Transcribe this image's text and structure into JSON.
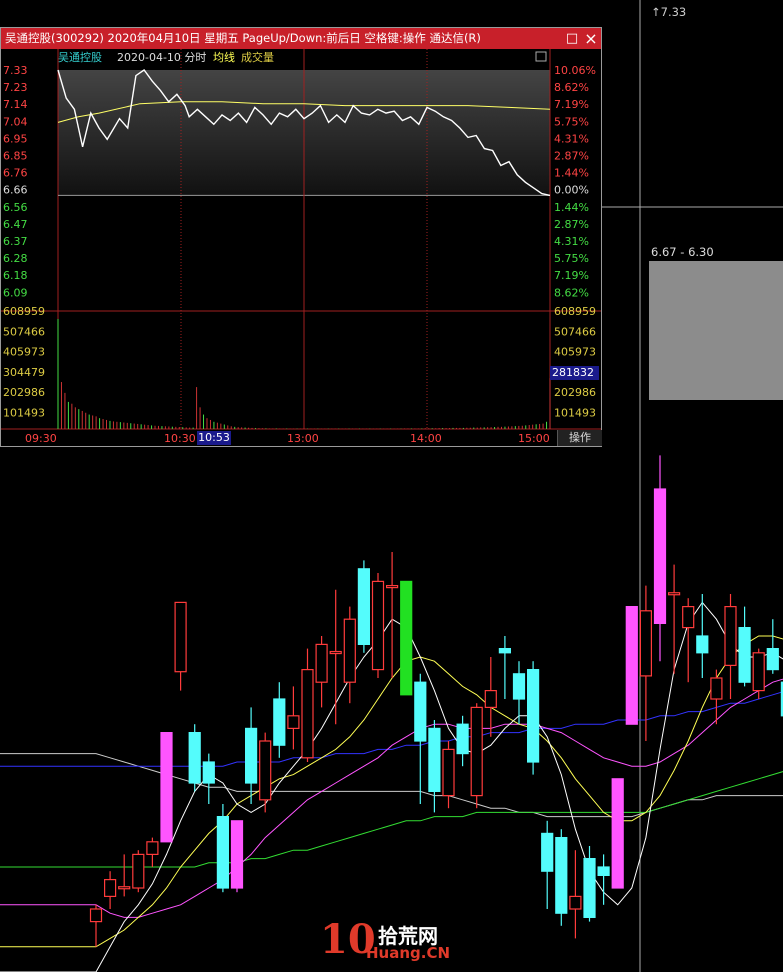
{
  "popup": {
    "title": "吴通控股(300292) 2020年04月10日 星期五 PageUp/Down:前后日 空格键:操作 通达信(R)",
    "legend_name": "吴通控股",
    "legend_date": "2020-04-10 分时",
    "legend_avg": "均线",
    "legend_vol": "成交量",
    "minimize_icon": "□",
    "close_icon": "×",
    "vol_current": "281832",
    "time_marker": "10:53",
    "op_tab": "操作"
  },
  "kchart": {
    "cursor_price": "7.33",
    "range_label": "6.67 - 6.30"
  },
  "watermark": {
    "num": "10",
    "cn": "拾荒网",
    "url": "Huang.CN"
  },
  "colors": {
    "up": "#ff3b3b",
    "down": "#54fcfc",
    "limit_up": "#ff55ff",
    "limit_down": "#22e022",
    "ma5": "#ffffff",
    "ma10": "#ffff55",
    "ma20": "#ff55ff",
    "ma60": "#3333ff",
    "ma120": "#33dd33",
    "ma250": "#cccccc",
    "price_line": "#ffffff",
    "avg_line": "#ffff66",
    "axis_red": "#ff4444",
    "axis_green": "#44dd44",
    "axis_vol": "#ddcc44"
  },
  "chart_data": [
    {
      "type": "line",
      "title": "吴通控股 2020-04-10 分时",
      "x_ticks": [
        "09:30",
        "10:30",
        "13:00",
        "14:00",
        "15:00"
      ],
      "price_ticks": [
        "7.33",
        "7.23",
        "7.14",
        "7.04",
        "6.95",
        "6.85",
        "6.76",
        "6.66",
        "6.56",
        "6.47",
        "6.37",
        "6.28",
        "6.18",
        "6.09"
      ],
      "pct_ticks": [
        "10.06%",
        "8.62%",
        "7.19%",
        "5.75%",
        "4.31%",
        "2.87%",
        "1.44%",
        "0.00%",
        "1.44%",
        "2.87%",
        "4.31%",
        "5.75%",
        "7.19%",
        "8.62%"
      ],
      "vol_ticks": [
        "608959",
        "507466",
        "405973",
        "304479",
        "202986",
        "101493"
      ],
      "ylim": [
        6.0,
        7.33
      ],
      "prev_close": 6.66,
      "series": [
        {
          "name": "分时",
          "x": [
            0,
            4,
            8,
            12,
            16,
            20,
            24,
            30,
            34,
            38,
            42,
            46,
            50,
            54,
            58,
            62,
            64,
            68,
            72,
            76,
            80,
            84,
            88,
            92,
            96,
            100,
            104,
            108,
            112,
            116,
            120,
            124,
            128,
            132,
            136,
            140,
            144,
            148,
            152,
            156,
            160,
            164,
            168,
            172,
            176,
            180,
            184,
            188,
            192,
            196,
            200,
            204,
            208,
            212,
            216,
            220,
            224,
            228,
            232,
            236,
            240
          ],
          "values": [
            7.33,
            7.18,
            7.12,
            6.92,
            7.1,
            7.02,
            6.96,
            7.07,
            7.02,
            7.3,
            7.33,
            7.27,
            7.22,
            7.16,
            7.2,
            7.14,
            7.08,
            7.12,
            7.08,
            7.04,
            7.09,
            7.06,
            7.1,
            7.05,
            7.13,
            7.09,
            7.04,
            7.1,
            7.08,
            7.12,
            7.07,
            7.1,
            7.14,
            7.05,
            7.09,
            7.05,
            7.14,
            7.1,
            7.09,
            7.12,
            7.1,
            7.11,
            7.06,
            7.08,
            7.04,
            7.13,
            7.11,
            7.08,
            7.06,
            7.02,
            6.97,
            6.98,
            6.91,
            6.9,
            6.82,
            6.84,
            6.77,
            6.73,
            6.7,
            6.67,
            6.66
          ]
        },
        {
          "name": "均线",
          "x": [
            0,
            10,
            20,
            40,
            60,
            80,
            100,
            120,
            140,
            160,
            180,
            200,
            220,
            240
          ],
          "values": [
            7.05,
            7.08,
            7.1,
            7.15,
            7.16,
            7.16,
            7.15,
            7.15,
            7.14,
            7.14,
            7.14,
            7.14,
            7.13,
            7.12
          ]
        }
      ],
      "volume": [
        608959,
        260000,
        200000,
        150000,
        140000,
        120000,
        110000,
        100000,
        90000,
        80000,
        75000,
        70000,
        60000,
        55000,
        50000,
        45000,
        42000,
        40000,
        38000,
        36000,
        34000,
        32000,
        30000,
        28000,
        26000,
        24000,
        22000,
        20000,
        18000,
        17000,
        16000,
        15000,
        14000,
        13000,
        12000,
        11000,
        10000,
        9000,
        8000,
        8000,
        232000,
        120000,
        80000,
        60000,
        50000,
        40000,
        35000,
        30000,
        25000,
        20000,
        15000,
        12000,
        10000,
        9000,
        8000,
        7000,
        6000,
        5000,
        4500,
        4000,
        3500,
        3000,
        3000,
        3000,
        2500,
        2500,
        2500,
        2000,
        2000,
        2000,
        2000,
        2000,
        2000,
        2000,
        2000,
        2000,
        2000,
        2000,
        2000,
        2000,
        2000,
        2000,
        2000,
        2000,
        2000,
        2000,
        2000,
        2000,
        2000,
        2000,
        2000,
        2000,
        2000,
        2000,
        2000,
        2000,
        2000,
        2000,
        2000,
        2000,
        3000,
        3000,
        3000,
        3000,
        3000,
        3000,
        4000,
        4000,
        4000,
        4000,
        5000,
        5000,
        5000,
        5000,
        6000,
        6000,
        6000,
        6000,
        7000,
        7000,
        8000,
        8000,
        9000,
        9000,
        10000,
        10000,
        11000,
        12000,
        12000,
        13000,
        14000,
        15000,
        16000,
        17000,
        18000,
        20000,
        22000,
        24000,
        26000,
        28000,
        30000,
        40000,
        281832
      ]
    },
    {
      "type": "candlestick",
      "title": "",
      "candles": [
        {
          "o": 100,
          "h": 104,
          "l": 94,
          "c": 103,
          "t": "up"
        },
        {
          "o": 106,
          "h": 112,
          "l": 103,
          "c": 110,
          "t": "up"
        },
        {
          "o": 108,
          "h": 116,
          "l": 106,
          "c": 108.3,
          "t": "up"
        },
        {
          "o": 108,
          "h": 117,
          "l": 107,
          "c": 116,
          "t": "up"
        },
        {
          "o": 116,
          "h": 120,
          "l": 113,
          "c": 119,
          "t": "up"
        },
        {
          "o": 119,
          "h": 145,
          "l": 119,
          "c": 145,
          "t": "limit_up"
        },
        {
          "o": 159.5,
          "h": 166,
          "l": 155,
          "c": 176,
          "t": "up"
        },
        {
          "o": 145,
          "h": 147,
          "l": 131,
          "c": 133,
          "t": "down"
        },
        {
          "o": 138,
          "h": 140,
          "l": 128,
          "c": 133,
          "t": "down"
        },
        {
          "o": 125,
          "h": 128,
          "l": 107,
          "c": 108,
          "t": "down"
        },
        {
          "o": 108,
          "h": 124,
          "l": 107,
          "c": 124,
          "t": "limit_up"
        },
        {
          "o": 146,
          "h": 151,
          "l": 128,
          "c": 133,
          "t": "down"
        },
        {
          "o": 129,
          "h": 145,
          "l": 126,
          "c": 143,
          "t": "up"
        },
        {
          "o": 153,
          "h": 157,
          "l": 139,
          "c": 142,
          "t": "down"
        },
        {
          "o": 146,
          "h": 156,
          "l": 141,
          "c": 149,
          "t": "up"
        },
        {
          "o": 139,
          "h": 165,
          "l": 138,
          "c": 160,
          "t": "up"
        },
        {
          "o": 157,
          "h": 168,
          "l": 151,
          "c": 166,
          "t": "up"
        },
        {
          "o": 164,
          "h": 179,
          "l": 147,
          "c": 164.3,
          "t": "up"
        },
        {
          "o": 157,
          "h": 175,
          "l": 152,
          "c": 172,
          "t": "up"
        },
        {
          "o": 184,
          "h": 186,
          "l": 164,
          "c": 166,
          "t": "down"
        },
        {
          "o": 160,
          "h": 183,
          "l": 158,
          "c": 181,
          "t": "up"
        },
        {
          "o": 180,
          "h": 188,
          "l": 158,
          "c": 180,
          "t": "up"
        },
        {
          "o": 181,
          "h": 181,
          "l": 154,
          "c": 154,
          "t": "limit_down"
        },
        {
          "o": 157,
          "h": 159,
          "l": 128,
          "c": 143,
          "t": "down"
        },
        {
          "o": 146,
          "h": 148,
          "l": 126,
          "c": 131,
          "t": "down"
        },
        {
          "o": 130,
          "h": 143,
          "l": 127,
          "c": 141,
          "t": "up"
        },
        {
          "o": 147,
          "h": 149,
          "l": 137,
          "c": 140,
          "t": "down"
        },
        {
          "o": 130,
          "h": 152,
          "l": 127,
          "c": 151,
          "t": "up"
        },
        {
          "o": 151,
          "h": 163,
          "l": 144,
          "c": 155,
          "t": "up"
        },
        {
          "o": 165,
          "h": 168,
          "l": 153,
          "c": 164,
          "t": "down"
        },
        {
          "o": 159,
          "h": 162,
          "l": 147,
          "c": 153,
          "t": "down"
        },
        {
          "o": 160,
          "h": 162,
          "l": 135,
          "c": 138,
          "t": "down"
        },
        {
          "o": 121,
          "h": 124,
          "l": 103,
          "c": 112,
          "t": "down"
        },
        {
          "o": 120,
          "h": 122,
          "l": 99,
          "c": 102,
          "t": "down"
        },
        {
          "o": 103,
          "h": 117,
          "l": 96,
          "c": 106,
          "t": "up"
        },
        {
          "o": 115,
          "h": 118,
          "l": 100,
          "c": 101,
          "t": "down"
        },
        {
          "o": 111,
          "h": 116,
          "l": 104,
          "c": 113,
          "t": "down"
        },
        {
          "o": 108,
          "h": 134,
          "l": 108,
          "c": 134,
          "t": "limit_up"
        },
        {
          "o": 147,
          "h": 171,
          "l": 150,
          "c": 175,
          "t": "limit_up"
        },
        {
          "o": 174,
          "h": 180,
          "l": 143,
          "c": 158.5,
          "t": "up"
        },
        {
          "o": 171,
          "h": 211,
          "l": 162,
          "c": 203,
          "t": "limit_up"
        },
        {
          "o": 178,
          "h": 185,
          "l": 159,
          "c": 178.3,
          "t": "up"
        },
        {
          "o": 170,
          "h": 177,
          "l": 157,
          "c": 175,
          "t": "up"
        },
        {
          "o": 168,
          "h": 178,
          "l": 158,
          "c": 164,
          "t": "down"
        },
        {
          "o": 153,
          "h": 160,
          "l": 147,
          "c": 158,
          "t": "up"
        },
        {
          "o": 161,
          "h": 178,
          "l": 153,
          "c": 175,
          "t": "up"
        },
        {
          "o": 170,
          "h": 175,
          "l": 156,
          "c": 157,
          "t": "down"
        },
        {
          "o": 155,
          "h": 165,
          "l": 153,
          "c": 164,
          "t": "up"
        },
        {
          "o": 165,
          "h": 172,
          "l": 159,
          "c": 160,
          "t": "down"
        },
        {
          "o": 157,
          "h": 166,
          "l": 147,
          "c": 149,
          "t": "down"
        }
      ],
      "ma": {
        "ma5": [
          88,
          94,
          100,
          104,
          109,
          116,
          124,
          131,
          135,
          133,
          128,
          126,
          128,
          133,
          137,
          141,
          146,
          152,
          158,
          163,
          167,
          172,
          170,
          163,
          155,
          146,
          141,
          140,
          142,
          146,
          149,
          149,
          144,
          135,
          122,
          112,
          107,
          104,
          108,
          120,
          141,
          160,
          171,
          176,
          172,
          166,
          163,
          163,
          164,
          162
        ],
        "ma10": [
          94,
          96,
          98,
          101,
          104,
          108,
          113,
          117,
          121,
          124,
          128,
          130,
          132,
          134,
          135,
          137,
          139,
          141,
          144,
          148,
          153,
          158,
          162,
          163,
          162,
          159,
          156,
          154,
          151,
          149,
          147,
          146,
          143,
          139,
          134,
          130,
          126,
          124,
          124,
          126,
          130,
          136,
          143,
          151,
          158,
          163,
          166,
          168,
          168,
          167
        ],
        "ma20": [
          104,
          102,
          101,
          101,
          102,
          103,
          104,
          106,
          108,
          110,
          113,
          116,
          120,
          123,
          126,
          129,
          131,
          133,
          135,
          137,
          139,
          142,
          144,
          146,
          147,
          147,
          146,
          146,
          146,
          147,
          147,
          147,
          146,
          145,
          143,
          141,
          139,
          138,
          137,
          137,
          138,
          140,
          142,
          145,
          148,
          151,
          153,
          155,
          157,
          158
        ],
        "ma60": [
          137,
          137,
          137,
          137,
          137,
          137,
          137,
          137,
          137,
          137,
          138,
          138,
          138,
          138,
          139,
          139,
          139,
          140,
          140,
          140,
          141,
          141,
          142,
          142,
          143,
          143,
          144,
          144,
          145,
          145,
          145,
          146,
          146,
          146,
          147,
          147,
          147,
          148,
          148,
          148,
          149,
          149,
          150,
          150,
          151,
          152,
          152,
          153,
          154,
          155
        ],
        "ma120": [
          113,
          113,
          113,
          113,
          113,
          113,
          113,
          113,
          114,
          114,
          114,
          115,
          115,
          116,
          117,
          117,
          118,
          119,
          120,
          121,
          122,
          123,
          124,
          124,
          125,
          125,
          125,
          126,
          126,
          126,
          126,
          126,
          126,
          126,
          126,
          126,
          126,
          126,
          126,
          126,
          127,
          128,
          129,
          130,
          131,
          132,
          133,
          134,
          135,
          136
        ],
        "ma250": [
          140,
          139,
          138,
          137,
          136,
          135,
          134,
          133,
          132,
          132,
          131,
          131,
          131,
          131,
          131,
          131,
          131,
          131,
          131,
          131,
          131,
          131,
          131,
          131,
          130,
          130,
          129,
          128,
          127,
          127,
          126,
          126,
          125,
          125,
          125,
          125,
          125,
          125,
          125,
          126,
          127,
          128,
          129,
          129,
          130,
          130,
          130,
          130,
          130,
          130
        ]
      }
    }
  ]
}
